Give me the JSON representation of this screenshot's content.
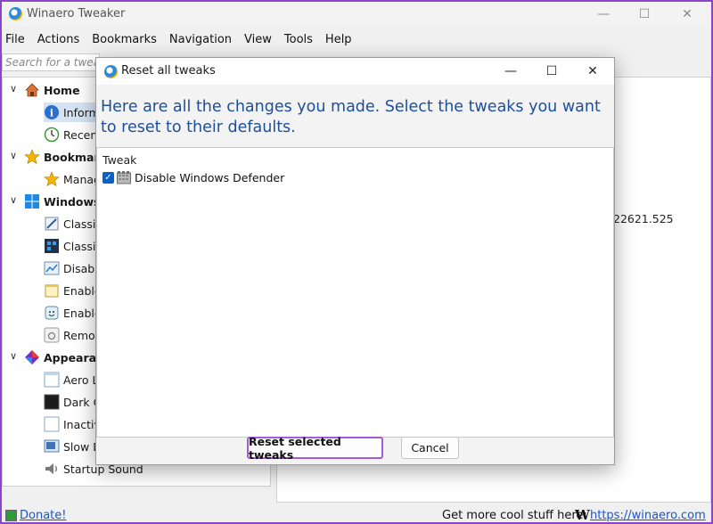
{
  "app": {
    "title": "Winaero Tweaker",
    "window_controls": {
      "minimize": "—",
      "maximize": "☐",
      "close": "✕"
    }
  },
  "menu": [
    "File",
    "Actions",
    "Bookmarks",
    "Navigation",
    "View",
    "Tools",
    "Help"
  ],
  "search": {
    "placeholder": "Search for a tweak"
  },
  "tree": {
    "home": {
      "label": "Home",
      "items": [
        "Information",
        "Recent"
      ]
    },
    "bookmarks": {
      "label": "Bookmarks",
      "items": [
        "Manage"
      ]
    },
    "windows": {
      "label": "Windows",
      "items": [
        "Classic",
        "Classic",
        "Disable",
        "Enable",
        "Enable",
        "Remove"
      ]
    },
    "appearance": {
      "label": "Appearance",
      "items": [
        "Aero Lite",
        "Dark Color",
        "Inactive",
        "Slow Down",
        "Startup Sound"
      ]
    }
  },
  "right_pane": {
    "version_fragment": "22621.525"
  },
  "statusbar": {
    "donate": "Donate!",
    "cool": "Get more cool stuff here:",
    "w_logo": "W",
    "site": "https://winaero.com"
  },
  "dialog": {
    "title": "Reset all tweaks",
    "instructions": "Here are all the changes you made. Select the tweaks you want to reset to their defaults.",
    "list_header": "Tweak",
    "items": [
      {
        "label": "Disable Windows Defender",
        "checked": true
      }
    ],
    "reset_button": "Reset selected tweaks",
    "cancel_button": "Cancel",
    "controls": {
      "minimize": "—",
      "maximize": "☐",
      "close": "✕"
    }
  },
  "colors": {
    "accent_blue": "#0b61c7",
    "instruction_text": "#1d4f9a",
    "highlight_border": "#a35cd8"
  }
}
